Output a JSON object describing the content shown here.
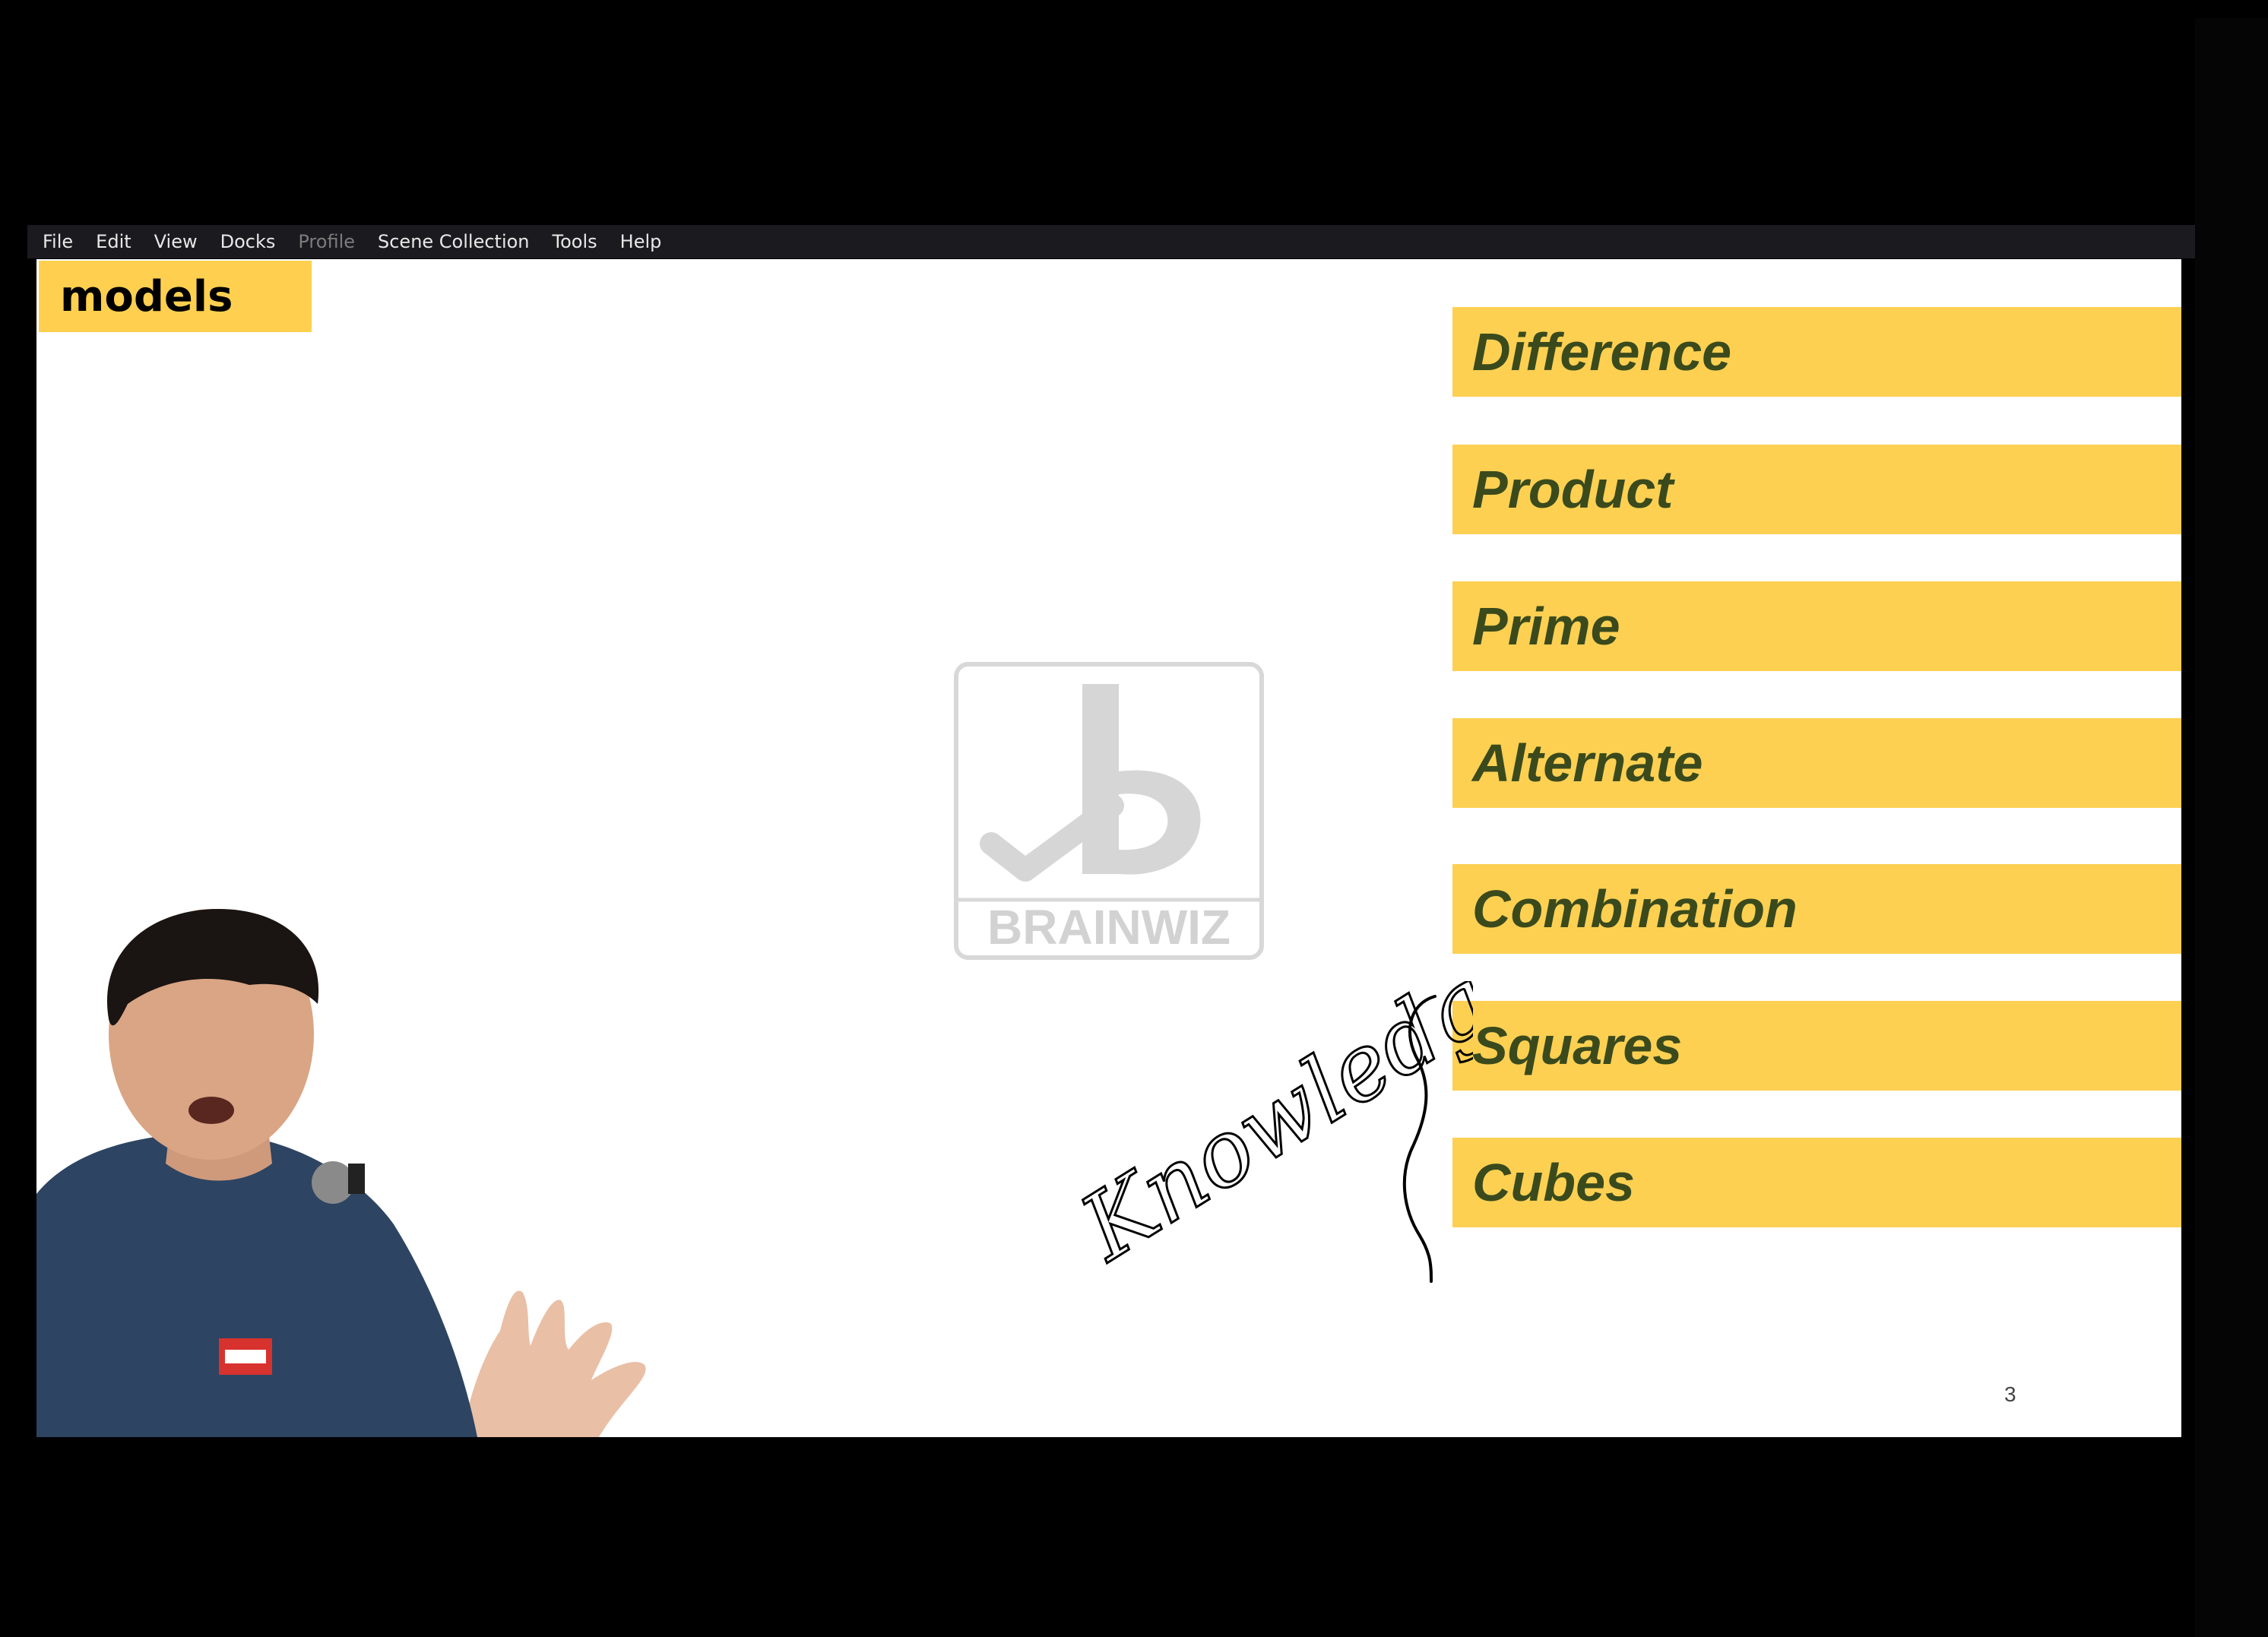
{
  "menu": {
    "file": "File",
    "edit": "Edit",
    "view": "View",
    "docks": "Docks",
    "profile": "Profile",
    "scene_collection": "Scene Collection",
    "tools": "Tools",
    "help": "Help"
  },
  "slide": {
    "title": "models",
    "items": [
      "Difference",
      "Product",
      "Prime",
      "Alternate",
      "Combination",
      "Squares",
      "Cubes"
    ],
    "handwritten_note": "Knowledge",
    "page_number": "3",
    "watermark_text": "BRAINWIZ"
  },
  "colors": {
    "bar_fill": "#fdd052",
    "bar_text": "#3a4a1c",
    "menubar_bg": "#1b1b1f"
  }
}
